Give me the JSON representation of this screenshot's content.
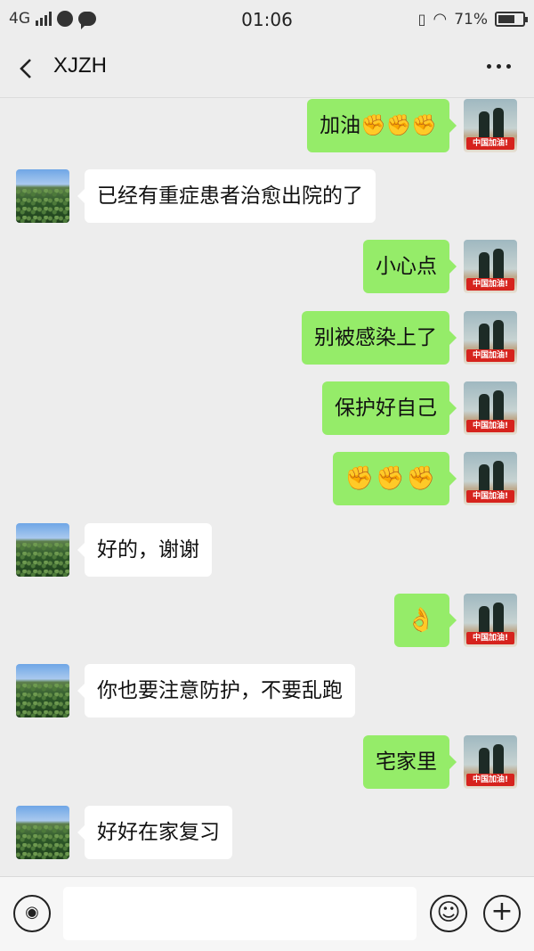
{
  "status_bar": {
    "network": "4G",
    "time": "01:06",
    "battery_text": "71%",
    "battery_level": 0.71
  },
  "header": {
    "title": "XJZH",
    "back_icon": "chevron-left-icon",
    "more_icon": "more-dots-icon"
  },
  "messages": [
    {
      "side": "out",
      "text": "加油✊✊✊"
    },
    {
      "side": "in",
      "text": "已经有重症患者治愈出院的了"
    },
    {
      "side": "out",
      "text": "小心点"
    },
    {
      "side": "out",
      "text": "别被感染上了"
    },
    {
      "side": "out",
      "text": "保护好自己"
    },
    {
      "side": "out",
      "text": "✊✊✊"
    },
    {
      "side": "in",
      "text": "好的，谢谢"
    },
    {
      "side": "out",
      "text": "👌"
    },
    {
      "side": "in",
      "text": "你也要注意防护，不要乱跑"
    },
    {
      "side": "out",
      "text": "宅家里"
    },
    {
      "side": "in",
      "text": "好好在家复习"
    }
  ],
  "avatar_badge_text": "中国加油!",
  "input_bar": {
    "voice_icon": "voice-icon",
    "emoji_icon": "emoji-icon",
    "plus_icon": "plus-icon",
    "text_value": ""
  },
  "colors": {
    "outgoing_bubble": "#95ec69",
    "incoming_bubble": "#ffffff",
    "background": "#ededed"
  }
}
